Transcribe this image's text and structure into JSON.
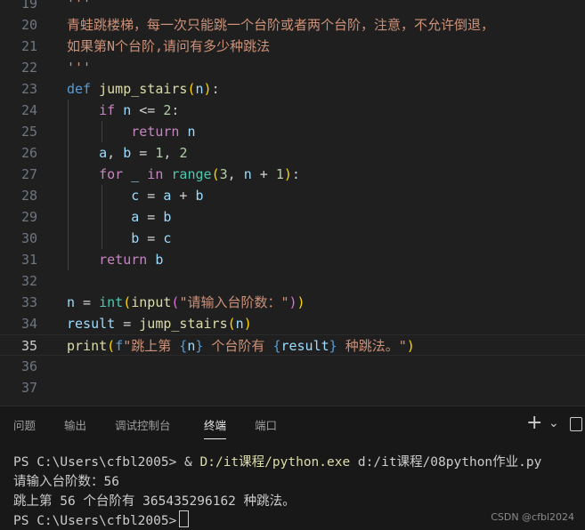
{
  "editor": {
    "lines": [
      {
        "n": "19",
        "tokens": [
          {
            "t": "'''",
            "c": "#ce9178"
          }
        ]
      },
      {
        "n": "20",
        "tokens": [
          {
            "t": "青蛙跳楼梯，每一次只能跳一个台阶或者两个台阶，注意，不允许倒退，",
            "c": "#ce9178"
          }
        ]
      },
      {
        "n": "21",
        "tokens": [
          {
            "t": "如果第N个台阶,请问有多少种跳法",
            "c": "#ce9178"
          }
        ]
      },
      {
        "n": "22",
        "tokens": [
          {
            "t": "'''",
            "c": "#ce9178"
          }
        ]
      },
      {
        "n": "23",
        "tokens": [
          {
            "t": "def ",
            "c": "#569cd6"
          },
          {
            "t": "jump_stairs",
            "c": "#dcdcaa"
          },
          {
            "t": "(",
            "c": "#ffd700"
          },
          {
            "t": "n",
            "c": "#9cdcfe"
          },
          {
            "t": ")",
            "c": "#ffd700"
          },
          {
            "t": ":",
            "c": "#cccccc"
          }
        ]
      },
      {
        "n": "24",
        "tokens": [
          {
            "t": "    "
          },
          {
            "t": "if ",
            "c": "#c586c0"
          },
          {
            "t": "n",
            "c": "#9cdcfe"
          },
          {
            "t": " <= ",
            "c": "#d4d4d4"
          },
          {
            "t": "2",
            "c": "#b5cea8"
          },
          {
            "t": ":",
            "c": "#cccccc"
          }
        ]
      },
      {
        "n": "25",
        "tokens": [
          {
            "t": "        "
          },
          {
            "t": "return ",
            "c": "#c586c0"
          },
          {
            "t": "n",
            "c": "#9cdcfe"
          }
        ]
      },
      {
        "n": "26",
        "tokens": [
          {
            "t": "    "
          },
          {
            "t": "a",
            "c": "#9cdcfe"
          },
          {
            "t": ", ",
            "c": "#cccccc"
          },
          {
            "t": "b",
            "c": "#9cdcfe"
          },
          {
            "t": " = ",
            "c": "#d4d4d4"
          },
          {
            "t": "1",
            "c": "#b5cea8"
          },
          {
            "t": ", ",
            "c": "#cccccc"
          },
          {
            "t": "2",
            "c": "#b5cea8"
          }
        ]
      },
      {
        "n": "27",
        "tokens": [
          {
            "t": "    "
          },
          {
            "t": "for ",
            "c": "#c586c0"
          },
          {
            "t": "_",
            "c": "#9cdcfe"
          },
          {
            "t": " in ",
            "c": "#c586c0"
          },
          {
            "t": "range",
            "c": "#4ec9b0"
          },
          {
            "t": "(",
            "c": "#ffd700"
          },
          {
            "t": "3",
            "c": "#b5cea8"
          },
          {
            "t": ", ",
            "c": "#cccccc"
          },
          {
            "t": "n",
            "c": "#9cdcfe"
          },
          {
            "t": " + ",
            "c": "#d4d4d4"
          },
          {
            "t": "1",
            "c": "#b5cea8"
          },
          {
            "t": ")",
            "c": "#ffd700"
          },
          {
            "t": ":",
            "c": "#cccccc"
          }
        ]
      },
      {
        "n": "28",
        "tokens": [
          {
            "t": "        "
          },
          {
            "t": "c",
            "c": "#9cdcfe"
          },
          {
            "t": " = ",
            "c": "#d4d4d4"
          },
          {
            "t": "a",
            "c": "#9cdcfe"
          },
          {
            "t": " + ",
            "c": "#d4d4d4"
          },
          {
            "t": "b",
            "c": "#9cdcfe"
          }
        ]
      },
      {
        "n": "29",
        "tokens": [
          {
            "t": "        "
          },
          {
            "t": "a",
            "c": "#9cdcfe"
          },
          {
            "t": " = ",
            "c": "#d4d4d4"
          },
          {
            "t": "b",
            "c": "#9cdcfe"
          }
        ]
      },
      {
        "n": "30",
        "tokens": [
          {
            "t": "        "
          },
          {
            "t": "b",
            "c": "#9cdcfe"
          },
          {
            "t": " = ",
            "c": "#d4d4d4"
          },
          {
            "t": "c",
            "c": "#9cdcfe"
          }
        ]
      },
      {
        "n": "31",
        "tokens": [
          {
            "t": "    "
          },
          {
            "t": "return ",
            "c": "#c586c0"
          },
          {
            "t": "b",
            "c": "#9cdcfe"
          }
        ]
      },
      {
        "n": "32",
        "tokens": []
      },
      {
        "n": "33",
        "tokens": [
          {
            "t": "n",
            "c": "#9cdcfe"
          },
          {
            "t": " = ",
            "c": "#d4d4d4"
          },
          {
            "t": "int",
            "c": "#4ec9b0"
          },
          {
            "t": "(",
            "c": "#ffd700"
          },
          {
            "t": "input",
            "c": "#dcdcaa"
          },
          {
            "t": "(",
            "c": "#da70d6"
          },
          {
            "t": "\"请输入台阶数：\"",
            "c": "#ce9178"
          },
          {
            "t": ")",
            "c": "#da70d6"
          },
          {
            "t": ")",
            "c": "#ffd700"
          }
        ]
      },
      {
        "n": "34",
        "tokens": [
          {
            "t": "result",
            "c": "#9cdcfe"
          },
          {
            "t": " = ",
            "c": "#d4d4d4"
          },
          {
            "t": "jump_stairs",
            "c": "#dcdcaa"
          },
          {
            "t": "(",
            "c": "#ffd700"
          },
          {
            "t": "n",
            "c": "#9cdcfe"
          },
          {
            "t": ")",
            "c": "#ffd700"
          }
        ]
      },
      {
        "n": "35",
        "tokens": [
          {
            "t": "print",
            "c": "#dcdcaa"
          },
          {
            "t": "(",
            "c": "#ffd700"
          },
          {
            "t": "f",
            "c": "#569cd6"
          },
          {
            "t": "\"跳上第 ",
            "c": "#ce9178"
          },
          {
            "t": "{",
            "c": "#569cd6"
          },
          {
            "t": "n",
            "c": "#9cdcfe"
          },
          {
            "t": "}",
            "c": "#569cd6"
          },
          {
            "t": " 个台阶有 ",
            "c": "#ce9178"
          },
          {
            "t": "{",
            "c": "#569cd6"
          },
          {
            "t": "result",
            "c": "#9cdcfe"
          },
          {
            "t": "}",
            "c": "#569cd6"
          },
          {
            "t": " 种跳法。\"",
            "c": "#ce9178"
          },
          {
            "t": ")",
            "c": "#ffd700"
          }
        ]
      },
      {
        "n": "36",
        "tokens": []
      },
      {
        "n": "37",
        "tokens": []
      }
    ]
  },
  "panel": {
    "tabs": [
      {
        "label": "问题",
        "active": false
      },
      {
        "label": "输出",
        "active": false
      },
      {
        "label": "调试控制台",
        "active": false
      },
      {
        "label": "终端",
        "active": true
      },
      {
        "label": "端口",
        "active": false
      }
    ],
    "add_icon": "+",
    "dropdown_icon": "⌄"
  },
  "terminal": {
    "lines": [
      [
        {
          "t": "PS C:\\Users\\cfbl2005> & ",
          "c": "#cccccc"
        },
        {
          "t": "D:/it课程/python.exe",
          "c": "#dcdcaa"
        },
        {
          "t": " d:/it课程/08python作业.py",
          "c": "#cccccc"
        }
      ],
      [
        {
          "t": "请输入台阶数：56",
          "c": "#cccccc"
        }
      ],
      [
        {
          "t": "跳上第 56 个台阶有 365435296162 种跳法。",
          "c": "#cccccc"
        }
      ],
      [
        {
          "t": "PS C:\\Users\\cfbl2005>",
          "c": "#cccccc"
        }
      ]
    ],
    "watermark": "CSDN @cfbl2024"
  }
}
